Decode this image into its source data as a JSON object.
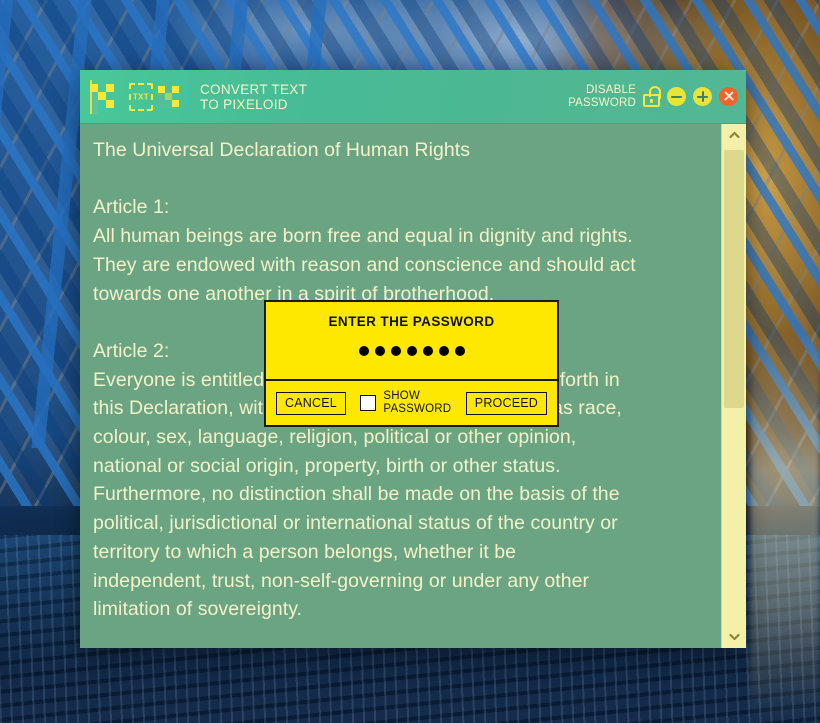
{
  "titlebar": {
    "app_icon": "pixeloid-p-logo",
    "convert_icon": "txt-to-pixeloid-icon",
    "title": "CONVERT TEXT\nTO PIXELOID",
    "disable_password_label": "DISABLE\nPASSWORD",
    "lock_icon": "unlocked-padlock-icon",
    "buttons": {
      "minimize": "minimize",
      "maximize": "maximize",
      "close": "close"
    }
  },
  "document": {
    "heading": "The Universal Declaration of Human Rights",
    "article1_title": "Article 1:",
    "article1_body": "All human beings are born free and equal in dignity and rights.\nThey are endowed with reason and conscience and should act\ntowards one another in a spirit of brotherhood.",
    "article2_title": "Article 2:",
    "article2_body": "Everyone is entitled to all the rights and freedoms set forth in\nthis Declaration, without distinction of any kind, such as race,\ncolour, sex, language, religion, political or other opinion,\nnational or social origin, property, birth or other status.\nFurthermore, no distinction shall be made on the basis of the\npolitical, jurisdictional or international status of the country or\nterritory to which a person belongs, whether it be\nindependent, trust, non-self-governing or under any other\nlimitation of sovereignty."
  },
  "scrollbar": {
    "up_icon": "chevron-up-icon",
    "down_icon": "chevron-down-icon"
  },
  "dialog": {
    "title": "ENTER THE PASSWORD",
    "password_dot_count": 7,
    "cancel_label": "CANCEL",
    "show_password_label": "SHOW\nPASSWORD",
    "show_password_checked": false,
    "proceed_label": "PROCEED"
  },
  "colors": {
    "titlebar_teal": "#49c79a",
    "doc_green": "#6ba483",
    "doc_text_cream": "#f3f2c9",
    "accent_yellow": "#ffe800",
    "icon_yellow": "#f5e93a",
    "close_orange": "#f4622a",
    "scrollbar_track": "#f2f0a9",
    "scrollbar_thumb": "#dcd98c"
  }
}
